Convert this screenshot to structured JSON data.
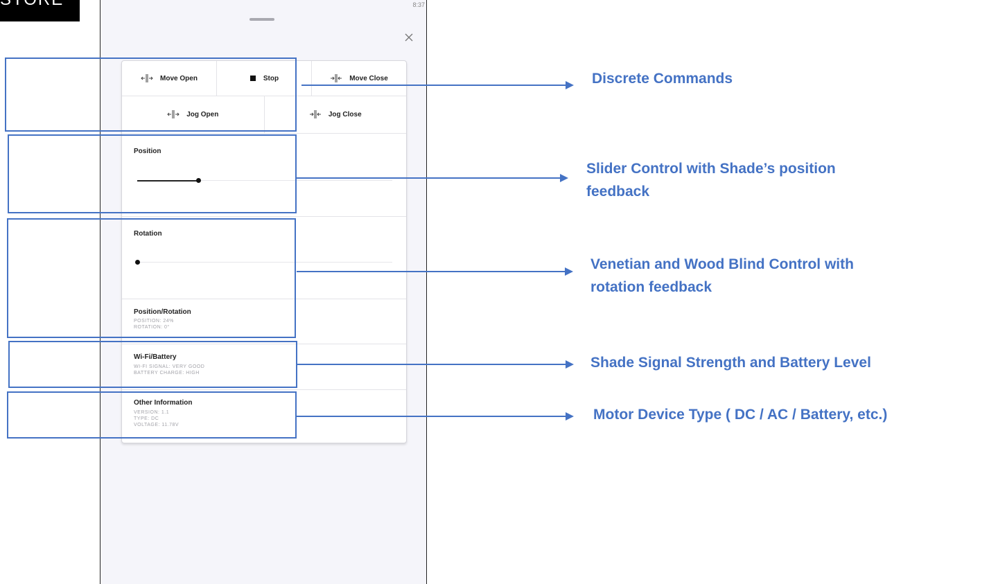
{
  "logo": {
    "text": "STORE"
  },
  "status_bar": {
    "time": "8:37"
  },
  "commands": {
    "move_open": "Move Open",
    "stop": "Stop",
    "move_close": "Move Close",
    "jog_open": "Jog Open",
    "jog_close": "Jog Close"
  },
  "position": {
    "title": "Position",
    "value": 24
  },
  "rotation": {
    "title": "Rotation",
    "value": 0
  },
  "position_rotation": {
    "title": "Position/Rotation",
    "position_line": "POSITION: 24%",
    "rotation_line": "ROTATION: 0°"
  },
  "wifi_battery": {
    "title": "Wi-Fi/Battery",
    "signal_line": "WI-FI SIGNAL: VERY GOOD",
    "battery_line": "BATTERY CHARGE: HIGH"
  },
  "other_info": {
    "title": "Other Information",
    "version_line": "VERSION: 1.1",
    "type_line": "TYPE: DC",
    "voltage_line": "VOLTAGE: 11.78V"
  },
  "annotations": {
    "discrete": "Discrete Commands",
    "slider_line1": "Slider Control with Shade’s position",
    "slider_line2": "feedback",
    "venetian_line1": "Venetian and Wood Blind Control with",
    "venetian_line2": "rotation feedback",
    "signal": "Shade Signal Strength and Battery Level",
    "motor": "Motor Device Type ( DC / AC / Battery, etc.)"
  },
  "colors": {
    "annotation": "#4472c4",
    "slider": "#222222"
  }
}
